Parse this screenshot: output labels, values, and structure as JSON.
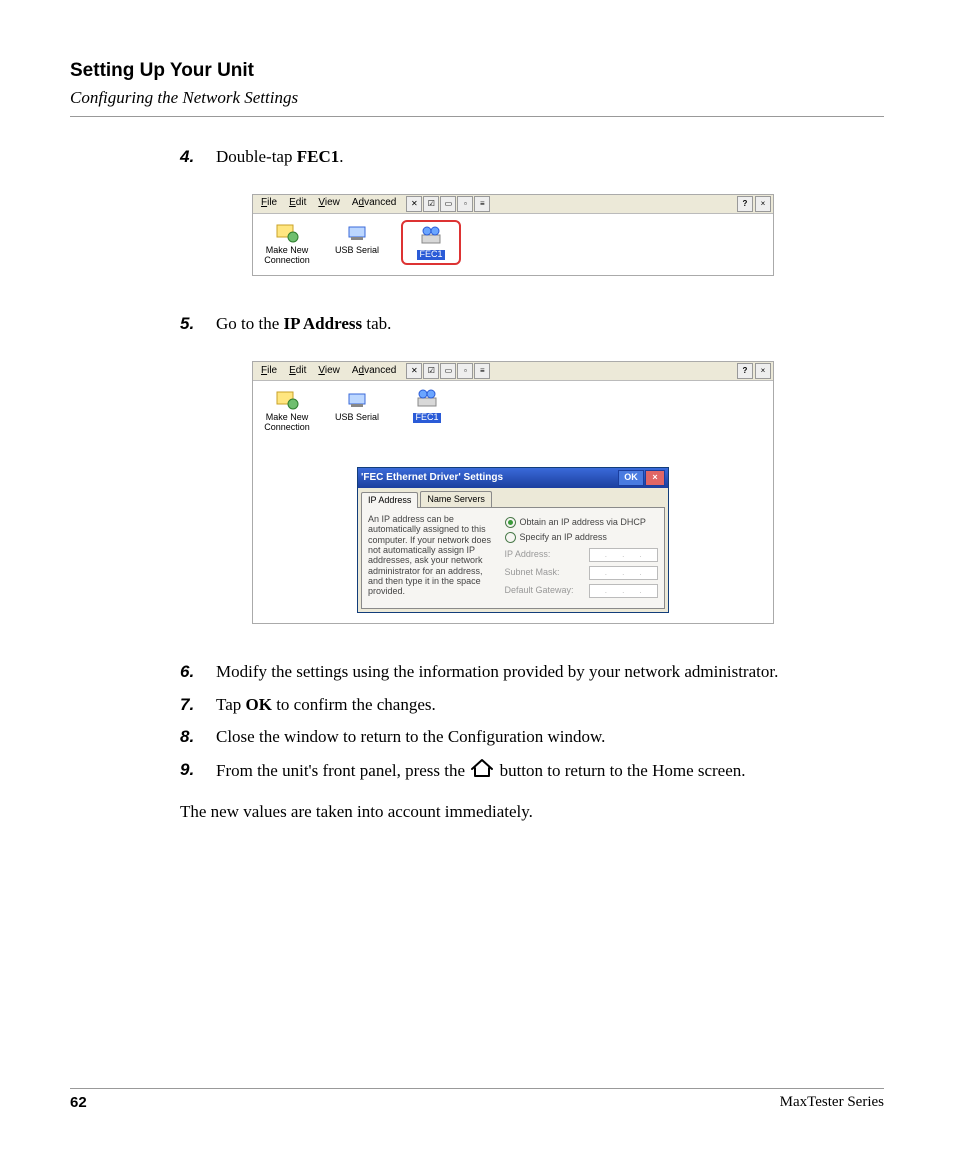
{
  "header": {
    "title": "Setting Up Your Unit",
    "subtitle": "Configuring the Network Settings"
  },
  "steps": {
    "s4": {
      "num": "4.",
      "pre": "Double-tap ",
      "bold": "FEC1",
      "post": "."
    },
    "s5": {
      "num": "5.",
      "pre": "Go to the ",
      "bold": "IP Address",
      "post": " tab."
    },
    "s6": {
      "num": "6.",
      "text": "Modify the settings using the information provided by your network administrator."
    },
    "s7": {
      "num": "7.",
      "pre": "Tap ",
      "bold": "OK",
      "post": " to confirm the changes."
    },
    "s8": {
      "num": "8.",
      "text": "Close the window to return to the Configuration window."
    },
    "s9": {
      "num": "9.",
      "pre": "From the unit's front panel, press the ",
      "post": " button to return to the Home screen."
    }
  },
  "closing": "The new values are taken into account immediately.",
  "shot1": {
    "menus": {
      "file": "File",
      "edit": "Edit",
      "view": "View",
      "advanced": "Advanced"
    },
    "help": "?",
    "close": "×",
    "icons": {
      "makeNew": "Make New Connection",
      "usb": "USB Serial",
      "fec1": "FEC1"
    }
  },
  "shot2": {
    "menus": {
      "file": "File",
      "edit": "Edit",
      "view": "View",
      "advanced": "Advanced"
    },
    "help": "?",
    "close": "×",
    "icons": {
      "makeNew": "Make New Connection",
      "usb": "USB Serial",
      "fec1": "FEC1"
    },
    "dialog": {
      "title": "'FEC Ethernet Driver' Settings",
      "ok": "OK",
      "close": "×",
      "tabs": {
        "ip": "IP Address",
        "ns": "Name Servers"
      },
      "leftText": "An IP address can be automatically assigned to this computer. If your network does not automatically assign IP addresses, ask your network administrator for an address, and then type it in the space provided.",
      "radio1": "Obtain an IP address via DHCP",
      "radio2": "Specify an IP address",
      "lbl_ip": "IP Address:",
      "lbl_mask": "Subnet Mask:",
      "lbl_gw": "Default Gateway:"
    }
  },
  "footer": {
    "page": "62",
    "series": "MaxTester Series"
  }
}
